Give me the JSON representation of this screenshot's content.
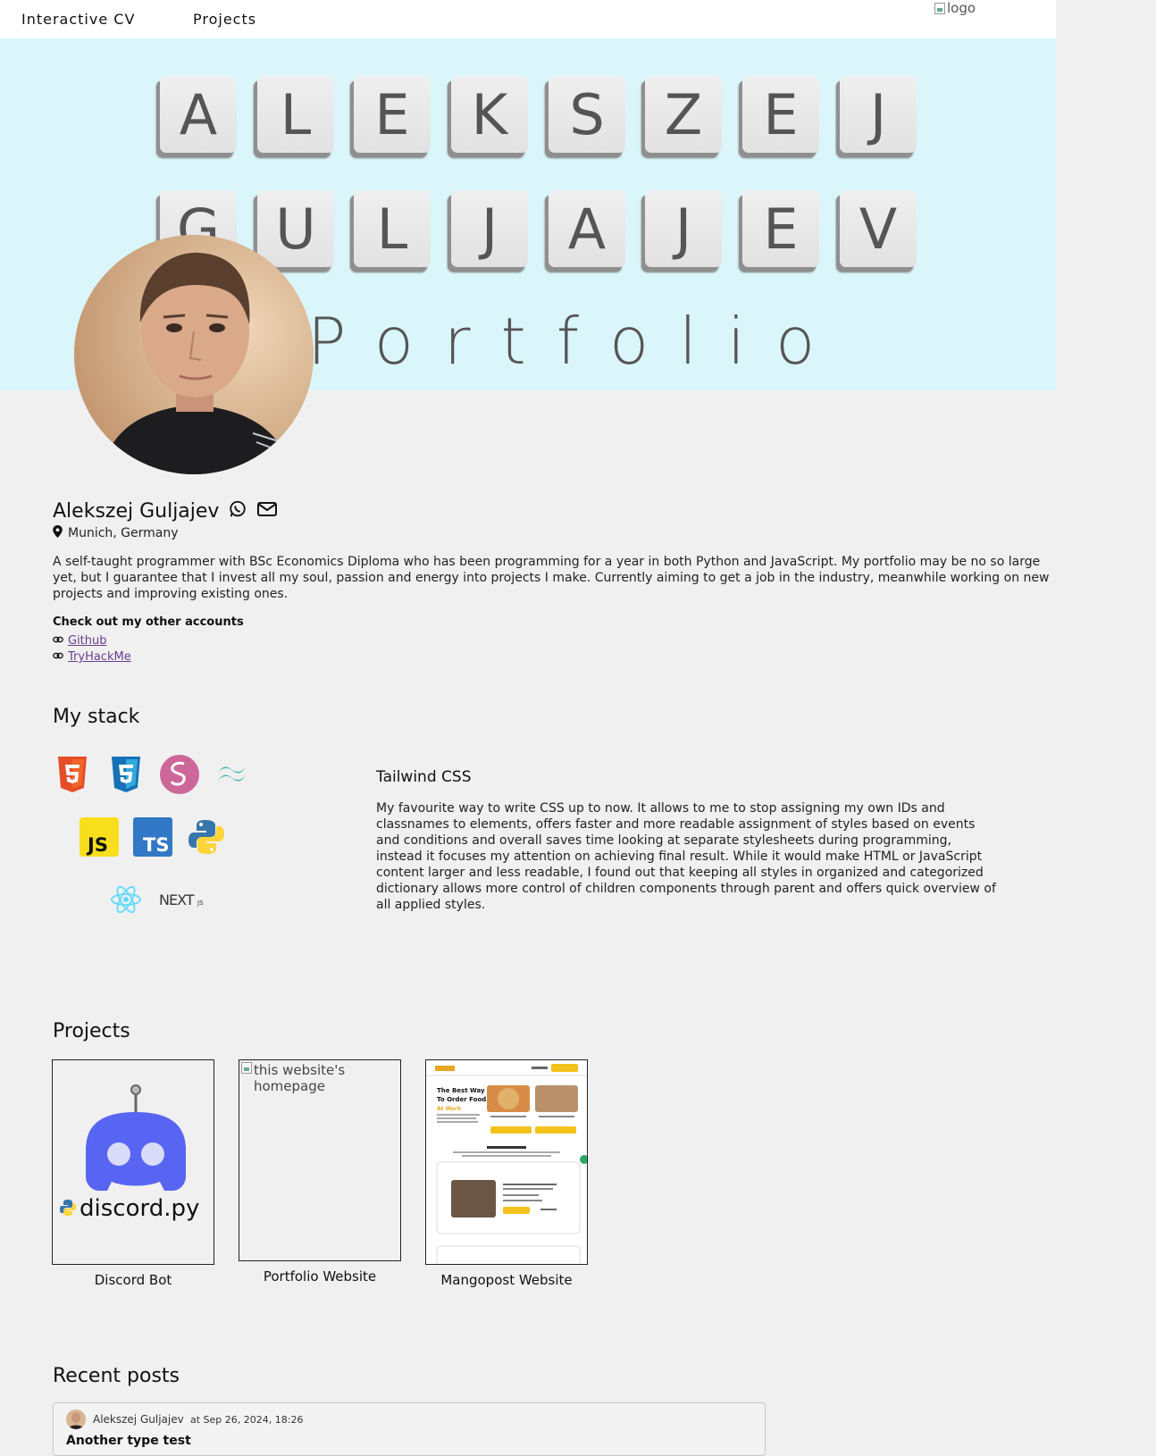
{
  "nav": {
    "links": [
      "Interactive CV",
      "Projects"
    ],
    "logo_alt": "logo"
  },
  "hero": {
    "row1": [
      "A",
      "L",
      "E",
      "K",
      "S",
      "Z",
      "E",
      "J"
    ],
    "row2": [
      "G",
      "U",
      "L",
      "J",
      "A",
      "J",
      "E",
      "V"
    ],
    "subtitle": "Portfolio"
  },
  "profile": {
    "name": "Alekszej Guljajev",
    "location": "Munich, Germany",
    "about": "A self-taught programmer with BSc Economics Diploma who has been programming for a year in both Python and JavaScript. My portfolio may be no so large yet, but I guarantee that I invest all my soul, passion and energy into projects I make. Currently aiming to get a job in the industry, meanwhile working on new projects and improving existing ones.",
    "accounts_title": "Check out my other accounts",
    "accounts": [
      "Github",
      "TryHackMe"
    ]
  },
  "stack": {
    "title": "My stack",
    "icons": [
      "html5-icon",
      "css3-icon",
      "sass-icon",
      "tailwind-icon",
      "javascript-icon",
      "typescript-icon",
      "python-icon",
      "react-icon",
      "nextjs-icon"
    ],
    "icon_labels": {
      "js": "JS",
      "ts": "TS",
      "next": "NEXT"
    },
    "selected": {
      "title": "Tailwind CSS",
      "description": "My favourite way to write CSS up to now. It allows to me to stop assigning my own IDs and classnames to elements, offers faster and more readable assignment of styles based on events and conditions and overall saves time looking at separate stylesheets during programming, instead it focuses my attention on achieving final result. While it would make HTML or JavaScript content larger and less readable, I found out that keeping all styles in organized and categorized dictionary allows more control of children components through parent and offers quick overview of all applied styles."
    }
  },
  "projects": {
    "title": "Projects",
    "items": [
      {
        "label": "Discord Bot",
        "thumb_text": "discord.py"
      },
      {
        "label": "Portfolio Website",
        "thumb_alt": "this website's homepage"
      },
      {
        "label": "Mangopost Website"
      }
    ],
    "mango_thumb": {
      "headline1": "The Best Way",
      "headline2": "To Order Food",
      "headline3": "At Work"
    }
  },
  "posts": {
    "title": "Recent posts",
    "items": [
      {
        "author": "Alekszej Guljajev",
        "date": "at Sep 26, 2024, 18:26",
        "title": "Another type test"
      }
    ]
  },
  "colors": {
    "hero_bg": "#dbf6fa",
    "page_bg": "#f0f0f0",
    "discord": "#5865f2",
    "link": "#6b3b8f"
  }
}
